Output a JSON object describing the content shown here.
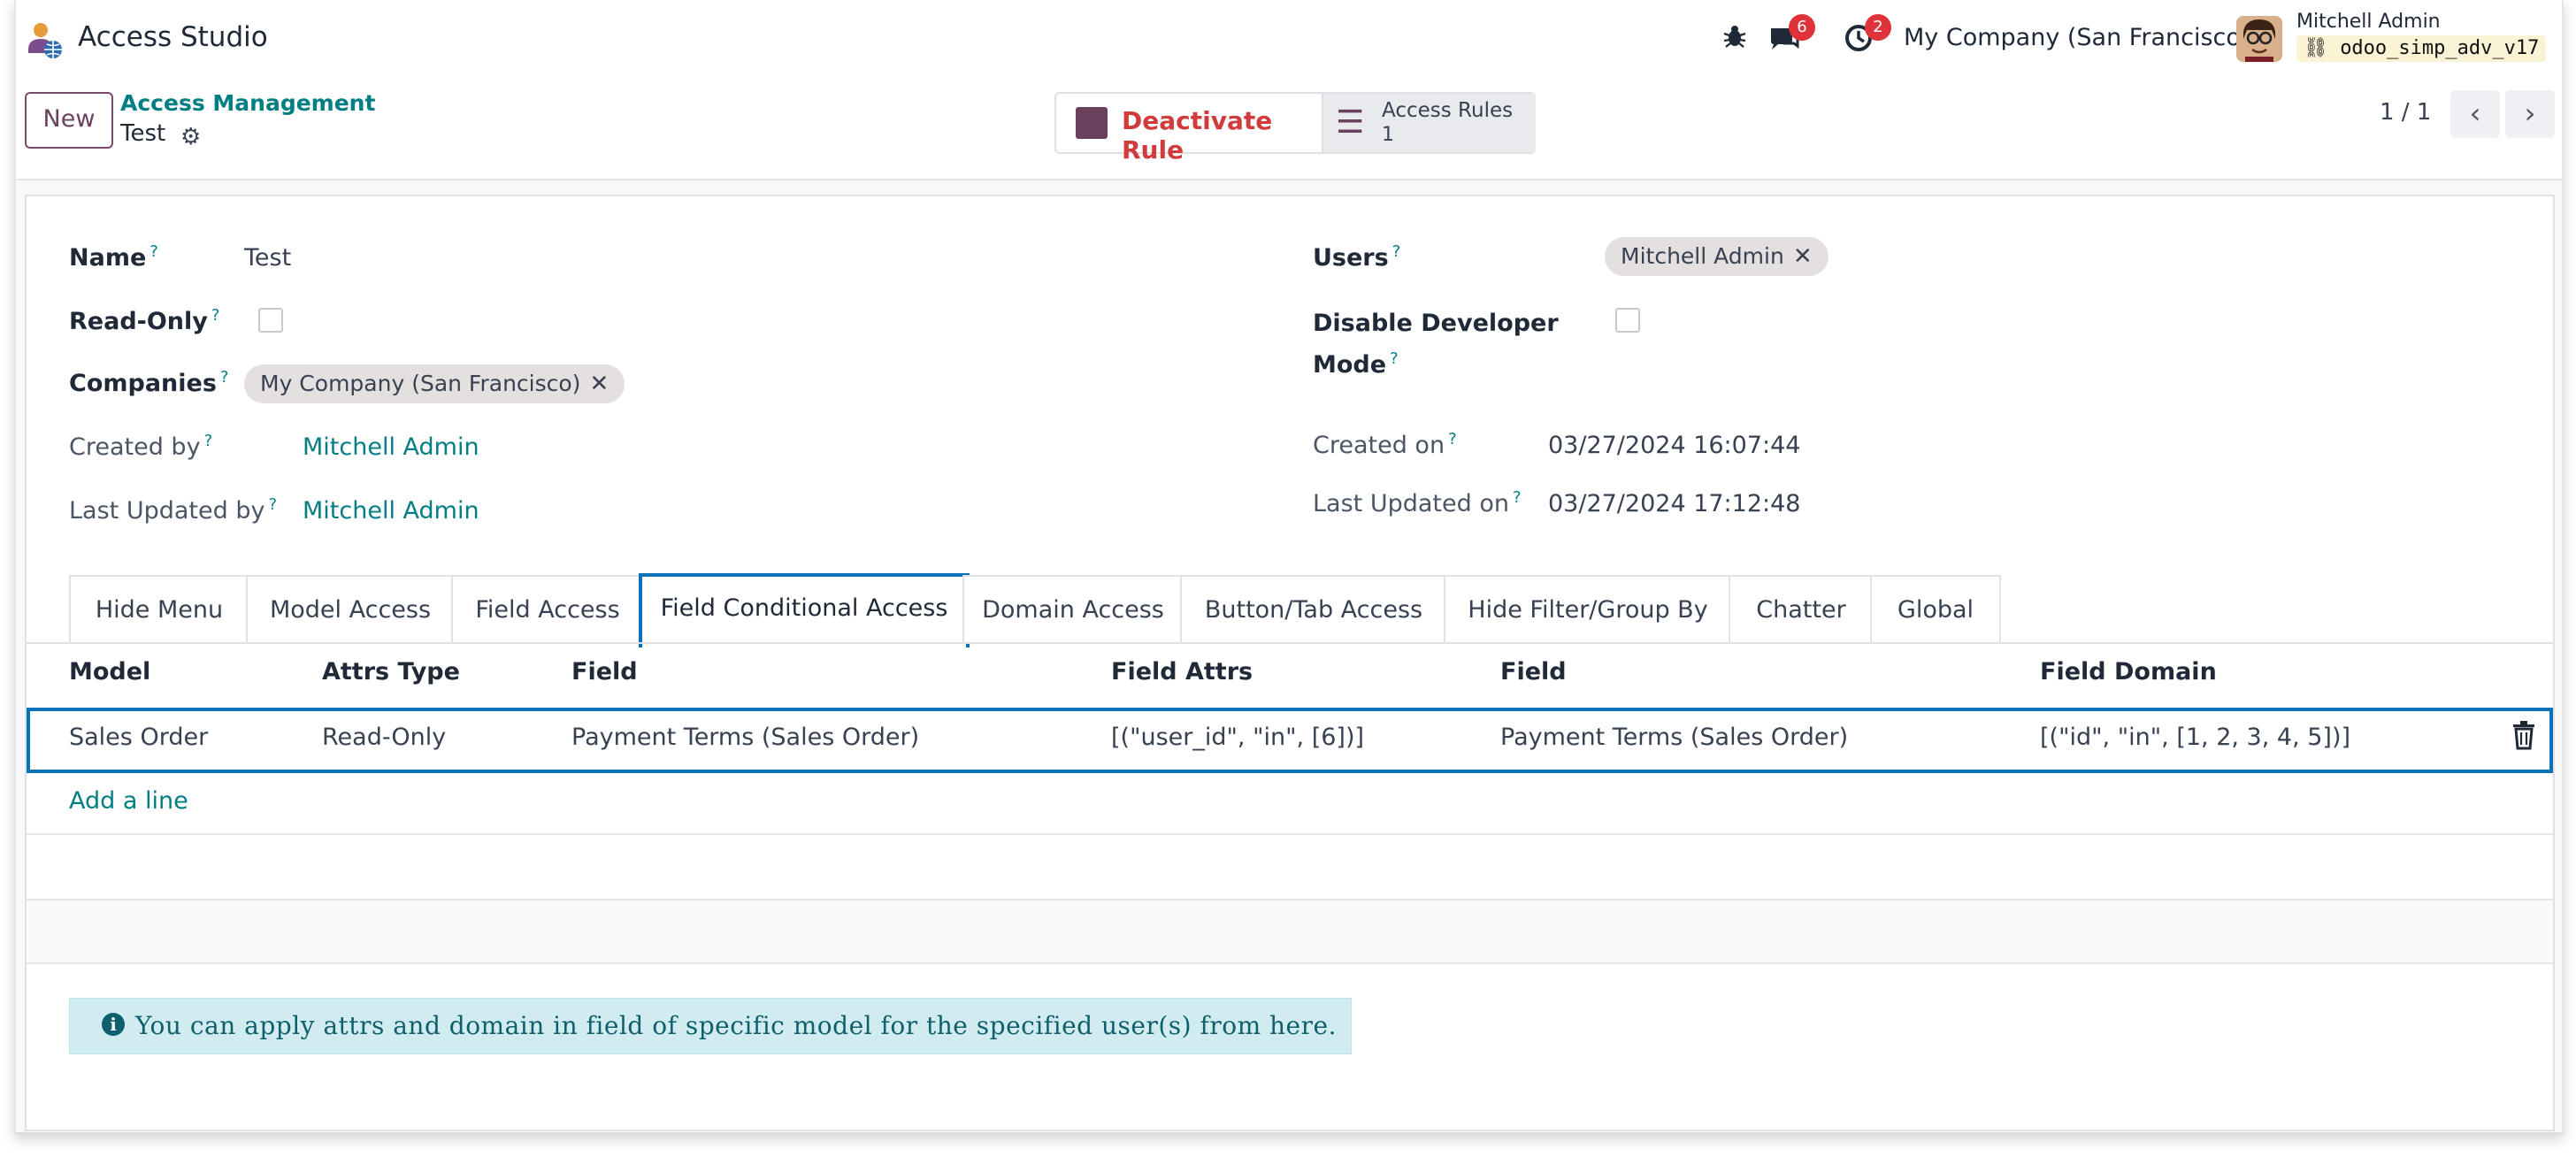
{
  "app": {
    "name": "Access Studio"
  },
  "systray": {
    "messages_count": "6",
    "activity_count": "2",
    "company": "My Company (San Francisco)",
    "user_name": "Mitchell Admin",
    "database": "odoo_simp_adv_v17"
  },
  "control": {
    "new_label": "New",
    "breadcrumb": "Access Management",
    "record_title": "Test",
    "deactivate_label": "Deactivate Rule",
    "access_rules_label": "Access Rules",
    "access_rules_count": "1",
    "pager": "1 / 1"
  },
  "form": {
    "name_label": "Name",
    "name_value": "Test",
    "readonly_label": "Read-Only",
    "companies_label": "Companies",
    "company_tag": "My Company (San Francisco)",
    "created_by_label": "Created by",
    "created_by_value": "Mitchell Admin",
    "last_updated_by_label": "Last Updated by",
    "last_updated_by_value": "Mitchell Admin",
    "users_label": "Users",
    "user_tag": "Mitchell Admin",
    "disable_dev_label_1": "Disable Developer",
    "disable_dev_label_2": "Mode",
    "created_on_label": "Created on",
    "created_on_value": "03/27/2024 16:07:44",
    "last_updated_on_label": "Last Updated on",
    "last_updated_on_value": "03/27/2024 17:12:48",
    "help_mark": "?"
  },
  "tabs": [
    {
      "label": "Hide Menu"
    },
    {
      "label": "Model Access"
    },
    {
      "label": "Field Access"
    },
    {
      "label": "Field Conditional Access"
    },
    {
      "label": "Domain Access"
    },
    {
      "label": "Button/Tab Access"
    },
    {
      "label": "Hide Filter/Group By"
    },
    {
      "label": "Chatter"
    },
    {
      "label": "Global"
    }
  ],
  "active_tab": "Field Conditional Access",
  "table": {
    "columns": [
      "Model",
      "Attrs Type",
      "Field",
      "Field Attrs",
      "Field",
      "Field Domain"
    ],
    "rows": [
      {
        "model": "Sales Order",
        "attrs_type": "Read-Only",
        "field": "Payment Terms (Sales Order)",
        "field_attrs": "[(\"user_id\", \"in\", [6])]",
        "field2": "Payment Terms (Sales Order)",
        "field_domain": "[(\"id\", \"in\", [1, 2, 3, 4, 5])]"
      }
    ],
    "add_line": "Add a line"
  },
  "info": {
    "text": "You can apply attrs and domain in field of specific model for the specified user(s) from here.",
    "icon": "i"
  },
  "colors": {
    "primary": "#6b3f5e",
    "accent": "#017e84",
    "danger": "#d03b3b",
    "focus": "#0b72b8",
    "alert_bg": "#d1ecf0"
  }
}
